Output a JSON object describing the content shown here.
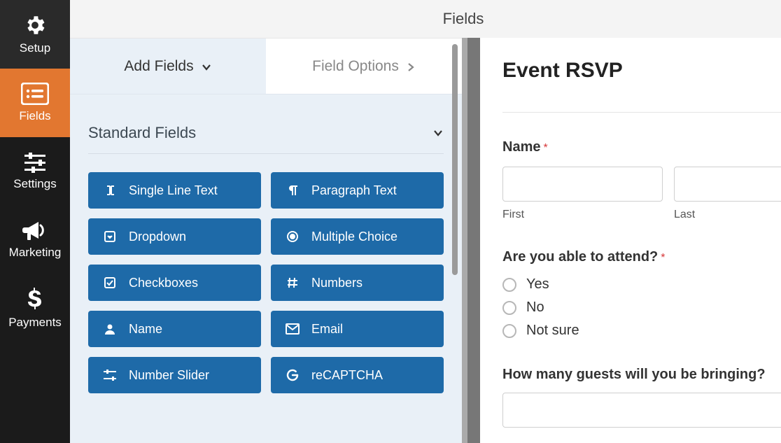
{
  "sidebar": {
    "items": [
      {
        "label": "Setup",
        "icon": "gear"
      },
      {
        "label": "Fields",
        "icon": "list"
      },
      {
        "label": "Settings",
        "icon": "sliders"
      },
      {
        "label": "Marketing",
        "icon": "bullhorn"
      },
      {
        "label": "Payments",
        "icon": "dollar"
      }
    ],
    "active_index": 1
  },
  "topbar": {
    "title": "Fields"
  },
  "tabs": {
    "add_fields": "Add Fields",
    "field_options": "Field Options",
    "active": "add_fields"
  },
  "standard_fields": {
    "heading": "Standard Fields",
    "items": [
      {
        "label": "Single Line Text",
        "icon": "text-cursor"
      },
      {
        "label": "Paragraph Text",
        "icon": "paragraph"
      },
      {
        "label": "Dropdown",
        "icon": "caret-square"
      },
      {
        "label": "Multiple Choice",
        "icon": "radio-dot"
      },
      {
        "label": "Checkboxes",
        "icon": "check-square"
      },
      {
        "label": "Numbers",
        "icon": "hash"
      },
      {
        "label": "Name",
        "icon": "user"
      },
      {
        "label": "Email",
        "icon": "envelope"
      },
      {
        "label": "Number Slider",
        "icon": "sliders-h"
      },
      {
        "label": "reCAPTCHA",
        "icon": "google-g"
      }
    ]
  },
  "preview": {
    "title": "Event RSVP",
    "name": {
      "label": "Name",
      "required": "*",
      "first_sub": "First",
      "last_sub": "Last"
    },
    "attend": {
      "label": "Are you able to attend?",
      "required": "*",
      "options": [
        "Yes",
        "No",
        "Not sure"
      ]
    },
    "guests": {
      "label": "How many guests will you be bringing?"
    }
  }
}
